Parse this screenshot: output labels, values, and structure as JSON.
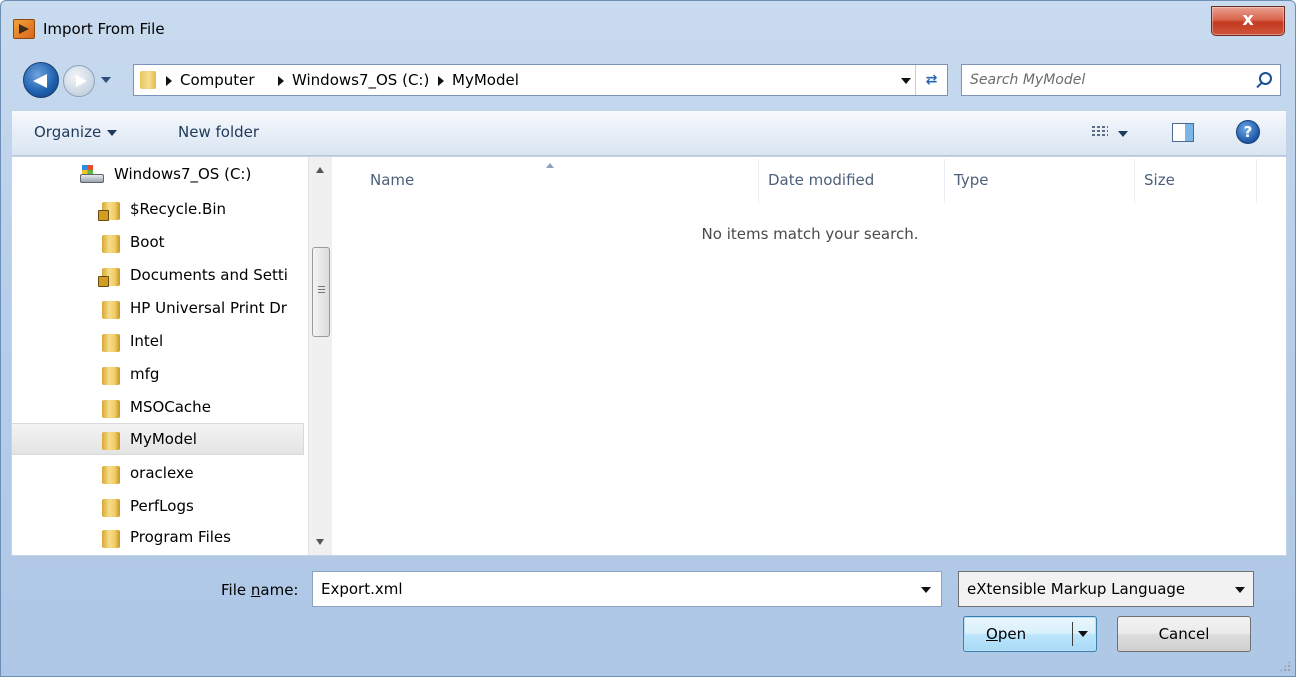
{
  "window": {
    "title": "Import From File",
    "close_label": "x"
  },
  "nav": {
    "breadcrumbs": [
      "Computer",
      "Windows7_OS (C:)",
      "MyModel"
    ],
    "refresh_icon": "refresh-icon",
    "search_placeholder": "Search MyModel"
  },
  "toolbar": {
    "organize_label": "Organize",
    "new_folder_label": "New folder",
    "help_label": "?"
  },
  "sidebar": {
    "items": [
      {
        "label": "Windows7_OS (C:)",
        "icon": "drive-icon",
        "locked": false
      },
      {
        "label": "$Recycle.Bin",
        "icon": "locked-folder-icon",
        "locked": true
      },
      {
        "label": "Boot",
        "icon": "folder-icon",
        "locked": false
      },
      {
        "label": "Documents and Setti",
        "icon": "locked-folder-icon",
        "locked": true
      },
      {
        "label": "HP Universal Print Dr",
        "icon": "folder-icon",
        "locked": false
      },
      {
        "label": "Intel",
        "icon": "folder-icon",
        "locked": false
      },
      {
        "label": "mfg",
        "icon": "folder-icon",
        "locked": false
      },
      {
        "label": "MSOCache",
        "icon": "folder-icon",
        "locked": false
      },
      {
        "label": "MyModel",
        "icon": "folder-icon",
        "locked": false,
        "selected": true
      },
      {
        "label": "oraclexe",
        "icon": "folder-icon",
        "locked": false
      },
      {
        "label": "PerfLogs",
        "icon": "folder-icon",
        "locked": false
      },
      {
        "label": "Program Files",
        "icon": "folder-icon",
        "locked": false
      }
    ]
  },
  "files": {
    "columns": [
      "Name",
      "Date modified",
      "Type",
      "Size"
    ],
    "empty_message": "No items match your search."
  },
  "footer": {
    "file_name_label_pre": "File ",
    "file_name_label_u": "n",
    "file_name_label_post": "ame:",
    "file_name_value": "Export.xml",
    "file_type_value": "eXtensible Markup Language",
    "open_label_u": "O",
    "open_label_rest": "pen",
    "cancel_label": "Cancel"
  },
  "colors": {
    "accent": "#3c7fb1",
    "chrome": "#b8cfea",
    "header_text": "#4c607a"
  }
}
